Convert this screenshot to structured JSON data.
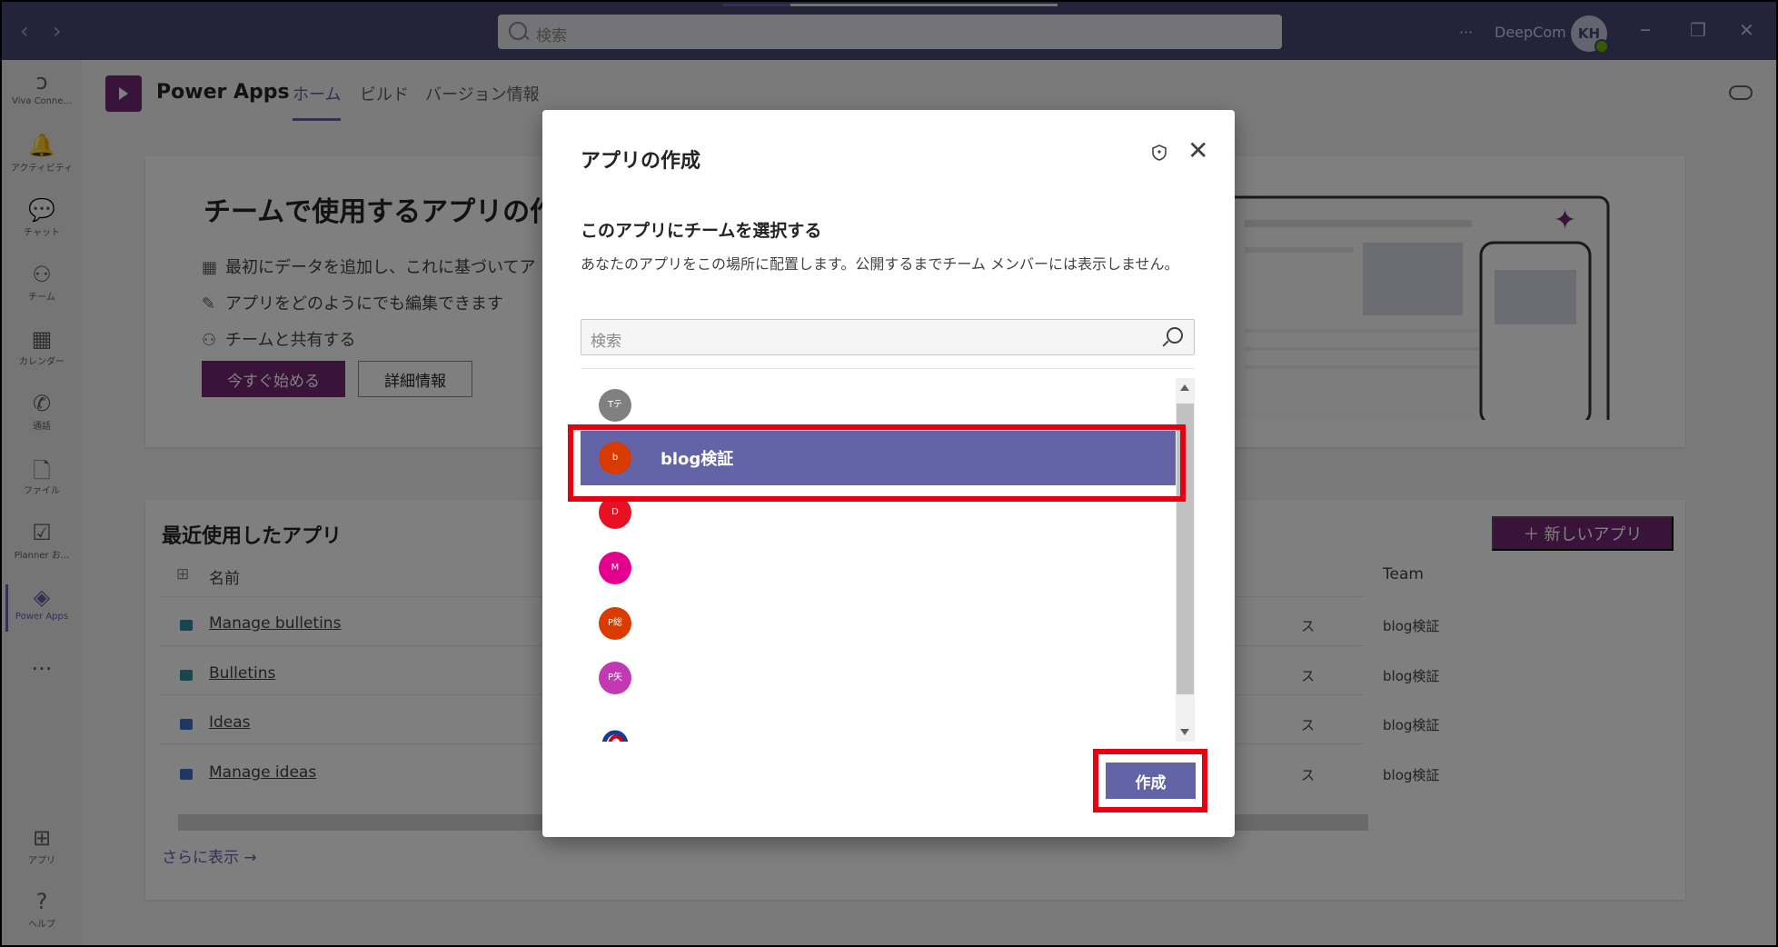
{
  "topbar": {
    "back_icon": "chevron-left-icon",
    "forward_icon": "chevron-right-icon",
    "search_placeholder": "検索",
    "more": "···",
    "org": "DeepCom",
    "avatar_initials": "KH",
    "minimize": "–",
    "maximize": "❐",
    "close": "✕"
  },
  "rail": {
    "items": [
      {
        "label": "Viva Conne...",
        "icon": "viva-connections-icon",
        "glyph": "ↄ"
      },
      {
        "label": "アクティビティ",
        "icon": "bell-icon",
        "glyph": "🔔"
      },
      {
        "label": "チャット",
        "icon": "chat-icon",
        "glyph": "💬"
      },
      {
        "label": "チーム",
        "icon": "teams-icon",
        "glyph": "⚇"
      },
      {
        "label": "カレンダー",
        "icon": "calendar-icon",
        "glyph": "▦"
      },
      {
        "label": "通話",
        "icon": "phone-icon",
        "glyph": "✆"
      },
      {
        "label": "ファイル",
        "icon": "file-icon",
        "glyph": "🗋"
      },
      {
        "label": "Planner お...",
        "icon": "planner-icon",
        "glyph": "☑"
      },
      {
        "label": "Power Apps",
        "icon": "power-apps-icon",
        "glyph": "◈"
      },
      {
        "label": "",
        "icon": "more-icon",
        "glyph": "···"
      }
    ],
    "bottom": [
      {
        "label": "アプリ",
        "icon": "apps-icon",
        "glyph": "⊞"
      },
      {
        "label": "ヘルプ",
        "icon": "help-icon",
        "glyph": "?"
      }
    ]
  },
  "app": {
    "title": "Power Apps",
    "tabs": [
      "ホーム",
      "ビルド",
      "バージョン情報"
    ]
  },
  "hero": {
    "title": "チームで使用するアプリの作",
    "bullets": [
      {
        "icon": "table-icon",
        "glyph": "▦",
        "text": "最初にデータを追加し、これに基づいてア"
      },
      {
        "icon": "edit-icon",
        "glyph": "✎",
        "text": "アプリをどのようにでも編集できます"
      },
      {
        "icon": "people-icon",
        "glyph": "⚇",
        "text": "チームと共有する"
      }
    ],
    "start_button": "今すぐ始める",
    "details_button": "詳細情報"
  },
  "recent": {
    "title": "最近使用したアプリ",
    "new_app_button": "新しいアプリ",
    "new_app_icon": "plus-icon",
    "columns": {
      "name": "名前",
      "team": "Team"
    },
    "rows": [
      {
        "name": "Manage bulletins",
        "suffix": "ス",
        "team": "blog検証",
        "icon_color": "#2e8f9b"
      },
      {
        "name": "Bulletins",
        "suffix": "ス",
        "team": "blog検証",
        "icon_color": "#2e8f9b"
      },
      {
        "name": "Ideas",
        "suffix": "ス",
        "team": "blog検証",
        "icon_color": "#3f6ec7"
      },
      {
        "name": "Manage ideas",
        "suffix": "ス",
        "team": "blog検証",
        "icon_color": "#3f6ec7"
      }
    ],
    "show_more": "さらに表示 →"
  },
  "modal": {
    "title": "アプリの作成",
    "shield_icon": "shield-icon",
    "close_label": "✕",
    "subtitle": "このアプリにチームを選択する",
    "description": "あなたのアプリをこの場所に配置します。公開するまでチーム メンバーには表示しません。",
    "search_placeholder": "検索",
    "teams": [
      {
        "initials": "Tテ",
        "name": "",
        "color": "#808080",
        "selected": false
      },
      {
        "initials": "b",
        "name": "blog検証",
        "color": "#d83b01",
        "selected": true
      },
      {
        "initials": "D",
        "name": "",
        "color": "#e81123",
        "selected": false
      },
      {
        "initials": "M",
        "name": "",
        "color": "#e3008c",
        "selected": false
      },
      {
        "initials": "P総",
        "name": "",
        "color": "#da3b01",
        "selected": false
      },
      {
        "initials": "P矢",
        "name": "",
        "color": "#c239b3",
        "selected": false
      },
      {
        "initials": "",
        "name": "",
        "color": "#ffffff",
        "selected": false
      }
    ],
    "create_button": "作成"
  },
  "colors": {
    "teams_purple": "#6264a7",
    "powerapps_purple": "#742774",
    "highlight_red": "#e60012"
  }
}
